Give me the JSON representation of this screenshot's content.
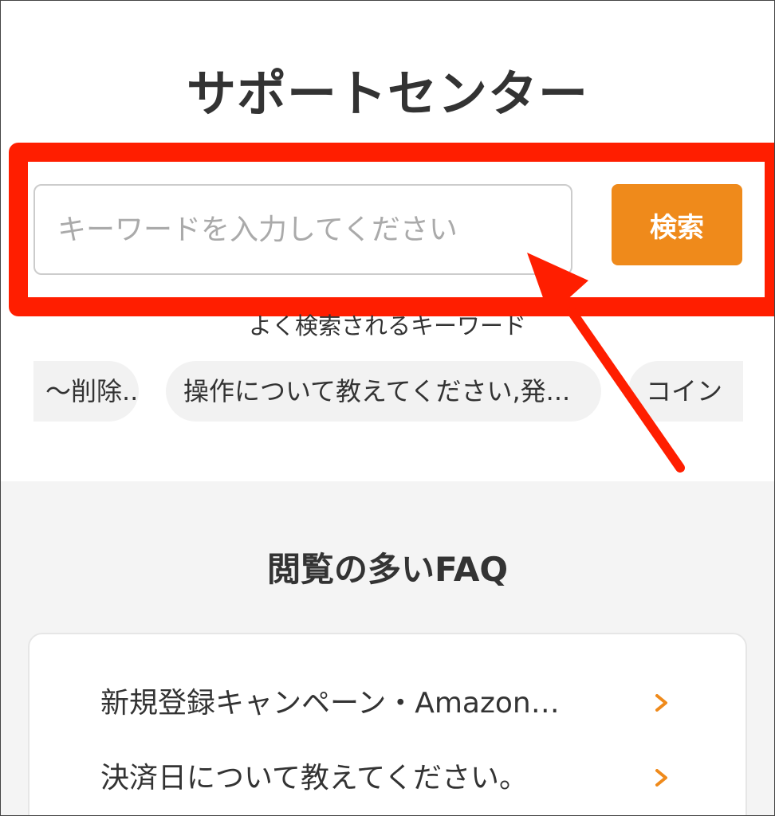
{
  "header": {
    "title": "サポートセンター"
  },
  "search": {
    "placeholder": "キーワードを入力してください",
    "button_label": "検索"
  },
  "keywords": {
    "label": "よく検索されるキーワード",
    "chips": [
      "〜削除...",
      "操作について教えてください,発...",
      "コイン"
    ]
  },
  "faq": {
    "title": "閲覧の多いFAQ",
    "items": [
      "新規登録キャンペーン・Amazon…",
      "決済日について教えてください。"
    ]
  },
  "colors": {
    "accent": "#ef8a1b",
    "annotation": "#ff1e00",
    "section_bg": "#f4f4f4"
  },
  "icons": {
    "faq_item": "chevron-right-icon",
    "annotation": "arrow-icon"
  }
}
